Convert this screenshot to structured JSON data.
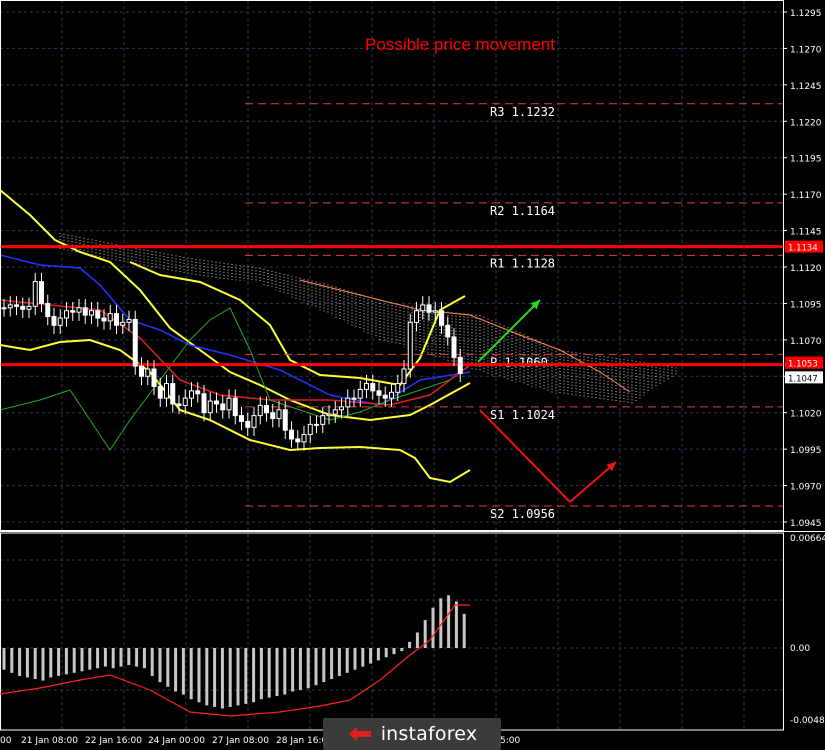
{
  "title": "Possible price movement",
  "colors": {
    "background": "#000000",
    "grid": "#2a3a55",
    "axis_text": "#ffffff",
    "level_dash": "#e03c3c",
    "level_solid": "#ff0000",
    "level_label": "#ffffff",
    "bollinger": "#ffff33",
    "ichimoku_cloud": "#ffffff",
    "rsi_green": "#22aa22",
    "mid_blue": "#2233ff",
    "candle_up": "#ffffff",
    "candle_down": "#ffffff",
    "arrow_up": "#22dd22",
    "arrow_down": "#ee1111",
    "macd_hist": "#c8c8c8",
    "macd_signal": "#ff2020"
  },
  "price_axis": {
    "labels": [
      "1.1295",
      "1.1270",
      "1.1245",
      "1.1220",
      "1.1195",
      "1.1170",
      "1.1145",
      "1.1120",
      "1.1095",
      "1.1070",
      "1.1045",
      "1.1020",
      "1.0995",
      "1.0970",
      "1.0945"
    ],
    "badges": [
      {
        "text": "1.1134",
        "bg": "#ff0000",
        "fg": "#ffffff"
      },
      {
        "text": "1.1053",
        "bg": "#ff0000",
        "fg": "#ffffff"
      },
      {
        "text": "1.1047",
        "bg": "#ffffff",
        "fg": "#000000"
      }
    ]
  },
  "levels": [
    {
      "label": "R3",
      "value_text": "1.1232",
      "value": 1.1232,
      "style": "dash"
    },
    {
      "label": "R2",
      "value_text": "1.1164",
      "value": 1.1164,
      "style": "dash"
    },
    {
      "label": "R1",
      "value_text": "1.1128",
      "value": 1.1128,
      "style": "dash"
    },
    {
      "label": "P",
      "value_text": "1.1060",
      "value": 1.106,
      "style": "dash"
    },
    {
      "label": "S1",
      "value_text": "1.1024",
      "value": 1.1024,
      "style": "dash"
    },
    {
      "label": "S2",
      "value_text": "1.0956",
      "value": 1.0956,
      "style": "dash"
    }
  ],
  "solid_lines": [
    1.1134,
    1.1053
  ],
  "time_axis": {
    "labels": [
      "00",
      "21 Jan 08:00",
      "22 Jan 16:00",
      "24 Jan 00:00",
      "27 Jan 08:00",
      "28 Jan 16:00",
      "5:00"
    ]
  },
  "macd_axis": {
    "labels": [
      "0.00664",
      "0.00",
      "-0.00481"
    ]
  },
  "watermark": {
    "text": "instaforex"
  },
  "chart_data": {
    "type": "line",
    "title": "Possible price movement",
    "ylim": [
      1.0935,
      1.1305
    ],
    "x": [
      0,
      1,
      2,
      3,
      4,
      5,
      6,
      7,
      8,
      9,
      10,
      11,
      12,
      13,
      14,
      15,
      16,
      17,
      18,
      19,
      20,
      21,
      22,
      23,
      24,
      25,
      26,
      27,
      28,
      29,
      30,
      31,
      32,
      33,
      34,
      35,
      36,
      37,
      38,
      39,
      40,
      41,
      42,
      43,
      44,
      45,
      46,
      47,
      48,
      49,
      50,
      51,
      52,
      53,
      54,
      55,
      56,
      57,
      58,
      59,
      60,
      61,
      62,
      63,
      64,
      65,
      66,
      67,
      68,
      69,
      70,
      71,
      72,
      73,
      74,
      75,
      76,
      77
    ],
    "series": [
      {
        "name": "close",
        "values": [
          1.1092,
          1.1094,
          1.1093,
          1.1091,
          1.1093,
          1.111,
          1.1095,
          1.1086,
          1.108,
          1.1085,
          1.109,
          1.1089,
          1.1092,
          1.1087,
          1.109,
          1.1085,
          1.1083,
          1.1088,
          1.108,
          1.1082,
          1.1084,
          1.1052,
          1.1045,
          1.105,
          1.1038,
          1.103,
          1.104,
          1.1026,
          1.1025,
          1.103,
          1.1035,
          1.1033,
          1.102,
          1.1028,
          1.1026,
          1.1022,
          1.103,
          1.1018,
          1.1014,
          1.101,
          1.1018,
          1.1025,
          1.102,
          1.1016,
          1.1022,
          1.1008,
          1.1002,
          1.1,
          1.1005,
          1.1012,
          1.1012,
          1.1018,
          1.1019,
          1.1022,
          1.1024,
          1.103,
          1.103,
          1.1036,
          1.104,
          1.1035,
          1.1032,
          1.103,
          1.1034,
          1.104,
          1.105,
          1.1082,
          1.109,
          1.1094,
          1.1089,
          1.109,
          1.108,
          1.1072,
          1.1058,
          1.1047
        ]
      }
    ]
  },
  "arrows": [
    {
      "name": "forecast-up",
      "from": [
        73,
        1.106
      ],
      "to": [
        82,
        1.1098
      ]
    },
    {
      "name": "forecast-down",
      "from": [
        73,
        1.1025
      ],
      "to": [
        87,
        1.096
      ],
      "then": [
        95,
        1.0987
      ]
    }
  ]
}
